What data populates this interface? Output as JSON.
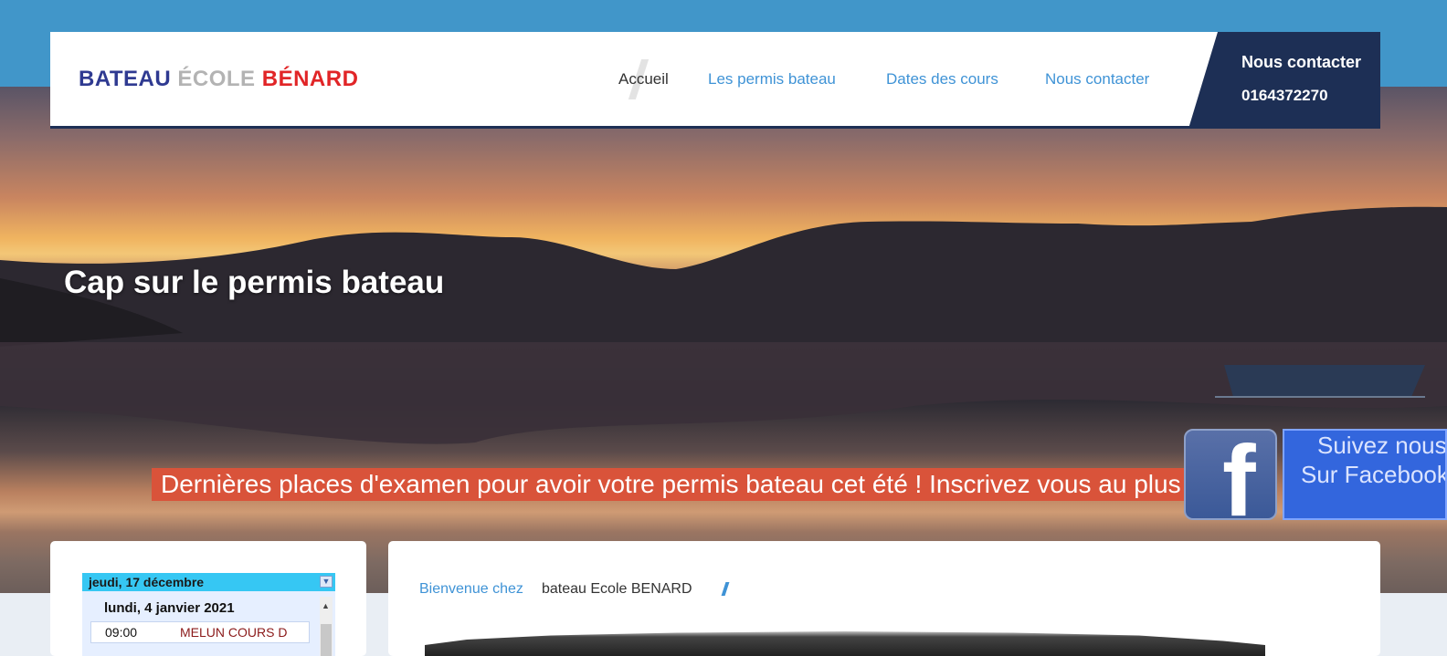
{
  "header": {
    "logo": {
      "part1": "BATEAU",
      "part2": "ÉCOLE",
      "part3": "BÉNARD"
    },
    "nav": [
      {
        "label": "Accueil",
        "active": true
      },
      {
        "label": "Les permis bateau",
        "active": false
      },
      {
        "label": "Dates des cours",
        "active": false
      },
      {
        "label": "Nous contacter",
        "active": false
      }
    ],
    "contact": {
      "title": "Nous contacter",
      "phone": "0164372270"
    }
  },
  "hero": {
    "title": "Cap sur le permis bateau",
    "ticker": "Dernières places d'examen pour avoir votre permis bateau cet été ! Inscrivez vous au plus vite !"
  },
  "facebook": {
    "line1": "Suivez nous",
    "line2": "Sur Facebook",
    "icon": "facebook-icon"
  },
  "calendar": {
    "header_date": "jeudi, 17 décembre",
    "day": "lundi, 4 janvier 2021",
    "events": [
      {
        "time": "09:00",
        "title": "MELUN COURS D"
      }
    ]
  },
  "breadcrumb": {
    "link": "Bienvenue chez",
    "current": "bateau Ecole BENARD"
  },
  "colors": {
    "top_band": "#4196c9",
    "header_dark": "#1d2f55",
    "nav_link": "#3f93d6",
    "ticker_bg": "#d9533a",
    "calendar_head": "#36c7f3",
    "logo_blue": "#2f3a91",
    "logo_grey": "#b3b3b3",
    "logo_red": "#e12527"
  }
}
